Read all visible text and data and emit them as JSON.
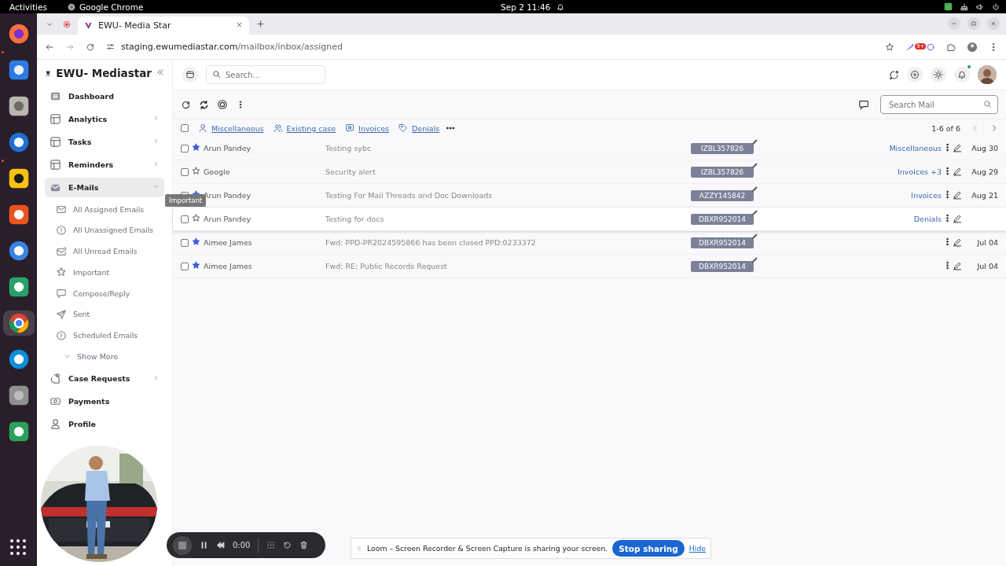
{
  "system_bar": {
    "activities": "Activities",
    "app": "Google Chrome",
    "clock": "Sep 2  11:46"
  },
  "browser": {
    "tab_title": "EWU- Media Star",
    "url_host": "staging.ewumediastar.com",
    "url_path": "/mailbox/inbox/assigned",
    "extension_badge": "9+"
  },
  "sidebar": {
    "brand": "EWU- Mediastar",
    "items": [
      {
        "label": "Dashboard",
        "kind": "link",
        "selected": false
      },
      {
        "label": "Analytics",
        "kind": "group",
        "expanded": false,
        "selected": false
      },
      {
        "label": "Tasks",
        "kind": "group",
        "expanded": false,
        "selected": false
      },
      {
        "label": "Reminders",
        "kind": "group",
        "expanded": false,
        "selected": false
      },
      {
        "label": "E-Mails",
        "kind": "group",
        "expanded": true,
        "selected": true,
        "show_more": "Show More",
        "children": [
          {
            "label": "All Assigned Emails"
          },
          {
            "label": "All Unassigned Emails"
          },
          {
            "label": "All Unread Emails"
          },
          {
            "label": "Important"
          },
          {
            "label": "Compose/Reply"
          },
          {
            "label": "Sent"
          },
          {
            "label": "Scheduled Emails"
          }
        ]
      },
      {
        "label": "Case Requests",
        "kind": "group",
        "expanded": false,
        "selected": false
      },
      {
        "label": "Payments",
        "kind": "link",
        "selected": false
      },
      {
        "label": "Profile",
        "kind": "link",
        "selected": false
      }
    ]
  },
  "header": {
    "search_placeholder": "Search..."
  },
  "toolbar": {
    "search_placeholder": "Search Mail"
  },
  "filters": [
    {
      "label": "Miscellaneous"
    },
    {
      "label": "Existing case"
    },
    {
      "label": "Invoices"
    },
    {
      "label": "Denials"
    }
  ],
  "select_all": {
    "checked": false
  },
  "pagination": "1-6 of 6",
  "rows": [
    {
      "sender": "Arun Pandey",
      "subject": "Testing sybc",
      "case_id": "IZBL357826",
      "labels": "Miscellaneous",
      "date": "Aug 30",
      "starred": true,
      "hovered": false
    },
    {
      "sender": "Google",
      "subject": "Security alert",
      "case_id": "IZBL357826",
      "labels": "Invoices +3",
      "date": "Aug 29",
      "starred": false,
      "hovered": false
    },
    {
      "sender": "Arun Pandey",
      "subject": "Testing For Mail Threads and Doc Downloads",
      "case_id": "AZZY145842",
      "labels": "Invoices",
      "date": "Aug 21",
      "starred": true,
      "hovered": false
    },
    {
      "sender": "Arun Pandey",
      "subject": "Testing for docs",
      "case_id": "DBXR952014",
      "labels": "Denials",
      "starred": false,
      "hovered": true
    },
    {
      "sender": "Aimee James",
      "subject": "Fwd: PPD-PR2024595866  has been closed PPD:0233372",
      "case_id": "DBXR952014",
      "date": "Jul 04",
      "starred": true,
      "hovered": false
    },
    {
      "sender": "Aimee James",
      "subject": "Fwd: RE: Public Records Request",
      "case_id": "DBXR952014",
      "date": "Jul 04",
      "starred": true,
      "hovered": false
    }
  ],
  "tooltip": "Important",
  "recorder": {
    "time": "0:00"
  },
  "loom": {
    "message": "Loom – Screen Recorder & Screen Capture is sharing your screen.",
    "stop": "Stop sharing",
    "hide": "Hide"
  }
}
